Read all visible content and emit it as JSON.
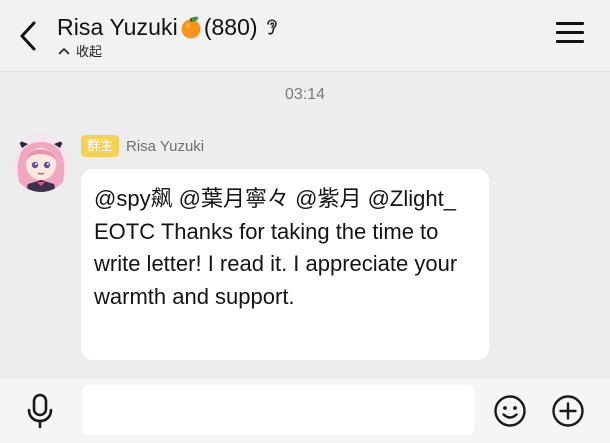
{
  "header": {
    "title_name": "Risa Yuzuki",
    "title_emoji": "orange-emoji",
    "member_count": "(880)",
    "collapse_label": "收起",
    "icons": [
      "back-arrow-icon",
      "ear-icon",
      "chevron-up-icon",
      "menu-icon"
    ]
  },
  "chat": {
    "timestamp": "03:14",
    "messages": [
      {
        "role_badge": "群主",
        "sender": "Risa Yuzuki",
        "text": "@spy飙 @葉月寧々 @紫月 @Zlight_ EOTC Thanks for taking the time to write letter! I read it. I appreciate your warmth and support."
      }
    ]
  },
  "input_bar": {
    "value": "",
    "icons": [
      "microphone-icon",
      "smiley-icon",
      "plus-icon"
    ]
  },
  "colors": {
    "background": "#ededed",
    "bubble": "#ffffff",
    "badge": "#f7d156",
    "text_secondary": "#7a7a7a"
  }
}
